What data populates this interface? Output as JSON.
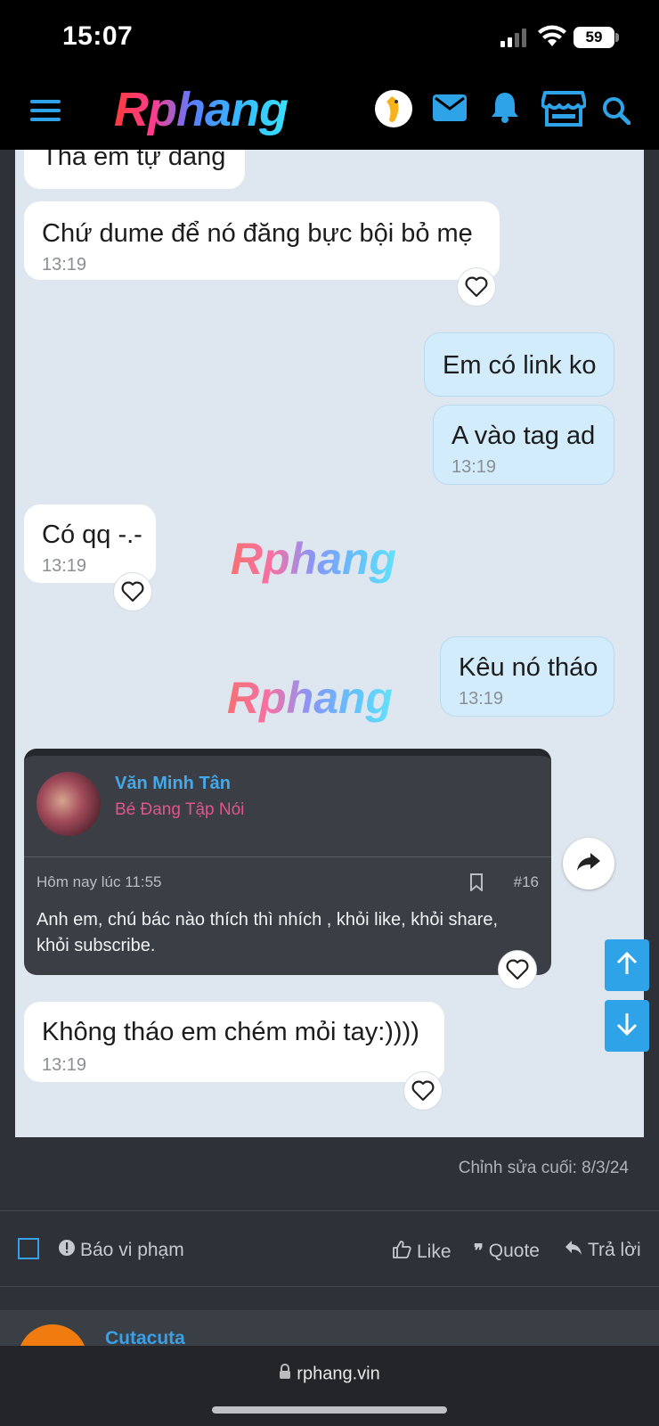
{
  "status_bar": {
    "time": "15:07",
    "battery": "59"
  },
  "header": {
    "logo": "Rphang"
  },
  "watermark": "Rphang",
  "messages": [
    {
      "text": "Thà em tự đăng",
      "time": ""
    },
    {
      "text": "Chứ dume để nó đăng bực bội bỏ mẹ",
      "time": "13:19"
    },
    {
      "text": "Em có link ko",
      "time": ""
    },
    {
      "text": "A vào tag ad",
      "time": "13:19"
    },
    {
      "text": "Có qq -.-",
      "time": "13:19"
    },
    {
      "text": "Kêu nó tháo",
      "time": "13:19"
    },
    {
      "text": "Không tháo em chém mỏi tay:))))",
      "time": "13:19"
    }
  ],
  "quote": {
    "name": "Văn Minh Tân",
    "title": "Bé Đang Tập Nói",
    "date": "Hôm nay lúc 11:55",
    "post_number": "#16",
    "body": "Anh em, chú bác nào thích thì nhích , khỏi like, khỏi share, khỏi subscribe."
  },
  "post_footer": {
    "edited": "Chỉnh sửa cuối: 8/3/24",
    "report": "Báo vi phạm",
    "like": "Like",
    "quote": "Quote",
    "reply": "Trả lời"
  },
  "next_post": {
    "author": "Cutacuta"
  },
  "browser": {
    "url": "rphang.vin"
  },
  "colors": {
    "accent": "#2ea3e8",
    "chat_bg": "#dee6ef",
    "page_bg": "#2e3238"
  }
}
